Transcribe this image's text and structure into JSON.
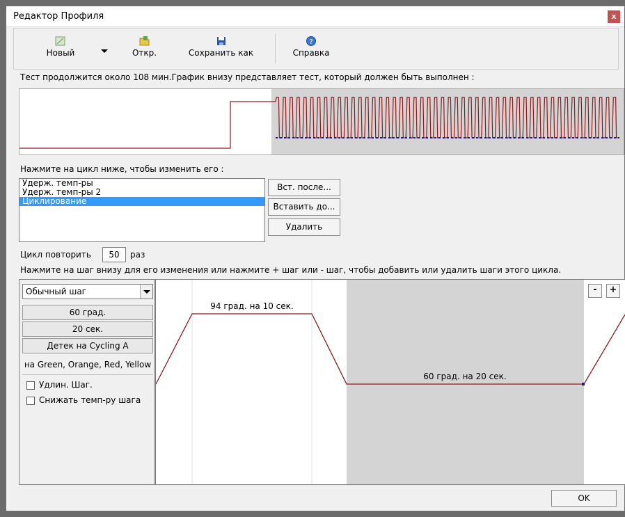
{
  "window": {
    "title": "Редактор Профиля",
    "close_label": "x"
  },
  "toolbar": {
    "new_label": "Новый",
    "open_label": "Откр.",
    "save_as_label": "Сохранить как",
    "help_label": "Справка"
  },
  "info_text": "Тест продолжится около 108 мин.График внизу представляет тест, который должен быть выполнен :",
  "overview": {
    "repetitions": 50
  },
  "cycles": {
    "instruction": "Нажмите на цикл ниже, чтобы изменить его :",
    "items": [
      "Удерж. темп-ры",
      "Удерж. темп-ры 2",
      "Циклирование"
    ],
    "selected_index": 2,
    "insert_after_label": "Вст. после...",
    "insert_before_label": "Вставить до...",
    "delete_label": "Удалить"
  },
  "repeat": {
    "prefix": "Цикл повторить",
    "value": "50",
    "suffix": "раз"
  },
  "steps_instruction": "Нажмите на шаг внизу для его изменения или нажмите + шаг или - шаг, чтобы добавить или удалить шаги этого цикла.",
  "step_panel": {
    "step_type": "Обычный шаг",
    "temperature_label": "60 град.",
    "duration_label": "20 сек.",
    "detection_label": "Детек на Cycling A",
    "channels_text": "на Green, Orange, Red, Yellow",
    "extend_step_label": "Удлин. Шаг.",
    "decrease_temp_label": "Снижать темп-ру шага"
  },
  "step_graph": {
    "minus_label": "-",
    "plus_label": "+",
    "steps": [
      {
        "label": "94 град. на 10 сек.",
        "temp": 94,
        "seconds": 10
      },
      {
        "label": "60 град. на 20 сек.",
        "temp": 60,
        "seconds": 20
      }
    ]
  },
  "ok_label": "OK",
  "colors": {
    "curve": "#8b1a1a",
    "selection": "#3399ff",
    "shade": "#d4d4d4"
  }
}
